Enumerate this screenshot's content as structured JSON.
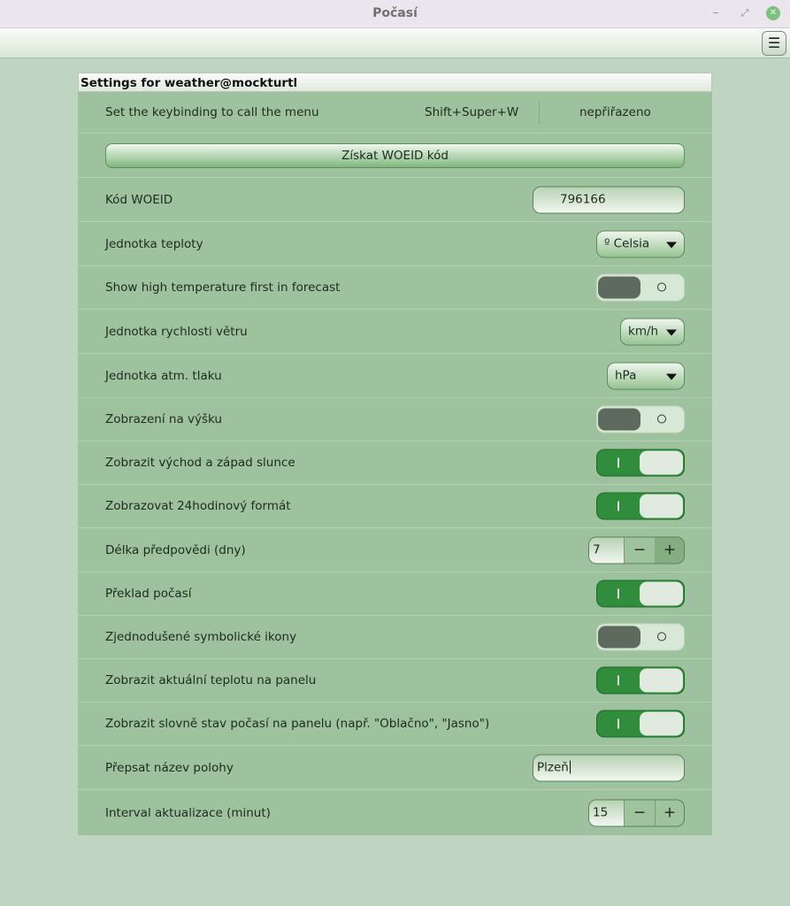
{
  "window": {
    "title": "Počasí"
  },
  "panel": {
    "header": "Settings for weather@mockturtl"
  },
  "rows": {
    "keybinding": {
      "label": "Set the keybinding to call the menu",
      "binding1": "Shift+Super+W",
      "binding2": "nepřiřazeno"
    },
    "woeid_button": {
      "label": "Získat WOEID kód"
    },
    "woeid": {
      "label": "Kód WOEID",
      "value": "796166"
    },
    "temp_unit": {
      "label": "Jednotka teploty",
      "value": "º Celsia"
    },
    "high_first": {
      "label": "Show high temperature first in forecast",
      "on": false
    },
    "wind_unit": {
      "label": "Jednotka rychlosti větru",
      "value": "km/h"
    },
    "pressure_unit": {
      "label": "Jednotka atm. tlaku",
      "value": "hPa"
    },
    "vertical": {
      "label": "Zobrazení na výšku",
      "on": false
    },
    "sunrise": {
      "label": "Zobrazit východ a západ slunce",
      "on": true
    },
    "clock24": {
      "label": "Zobrazovat 24hodinový formát",
      "on": true
    },
    "forecast_days": {
      "label": "Délka předpovědi (dny)",
      "value": "7"
    },
    "translate": {
      "label": "Překlad počasí",
      "on": true
    },
    "symbolic": {
      "label": "Zjednodušené symbolické ikony",
      "on": false
    },
    "panel_temp": {
      "label": "Zobrazit aktuální teplotu na panelu",
      "on": true
    },
    "panel_text": {
      "label": "Zobrazit slovně stav počasí na panelu (např. \"Oblačno\", \"Jasno\")",
      "on": true
    },
    "location_override": {
      "label": "Přepsat název polohy",
      "value": "Plzeň"
    },
    "refresh_interval": {
      "label": "Interval aktualizace (minut)",
      "value": "15"
    }
  },
  "icons": {
    "menu": "hamburger-menu-icon",
    "minimize": "minimize-icon",
    "maximize": "maximize-icon",
    "close": "close-icon"
  },
  "colors": {
    "accent_on": "#2f8d3b",
    "panel_bg": "#9ec29e",
    "window_bg": "#c0d4c2"
  }
}
